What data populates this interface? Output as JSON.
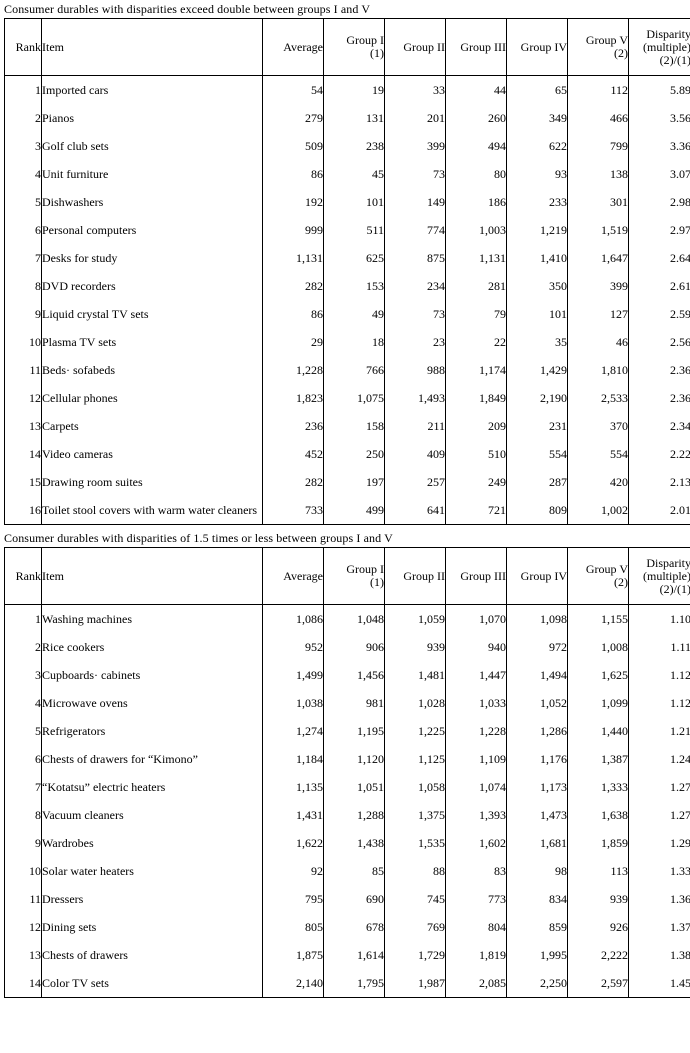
{
  "tables": [
    {
      "caption": "Consumer durables with disparities exceed double between groups I and V",
      "columns": {
        "rank": "Rank",
        "item": "Item",
        "average": "Average",
        "group1_l1": "Group I",
        "group1_l2": "(1)",
        "group2": "Group II",
        "group3": "Group III",
        "group4": "Group IV",
        "group5_l1": "Group V",
        "group5_l2": "(2)",
        "disparity_l1": "Disparity",
        "disparity_l2": "(multiple)",
        "disparity_l3": "(2)/(1)"
      },
      "rows": [
        {
          "rank": "1",
          "item": "Imported cars",
          "average": "54",
          "g1": "19",
          "g2": "33",
          "g3": "44",
          "g4": "65",
          "g5": "112",
          "disparity": "5.89"
        },
        {
          "rank": "2",
          "item": "Pianos",
          "average": "279",
          "g1": "131",
          "g2": "201",
          "g3": "260",
          "g4": "349",
          "g5": "466",
          "disparity": "3.56"
        },
        {
          "rank": "3",
          "item": "Golf club sets",
          "average": "509",
          "g1": "238",
          "g2": "399",
          "g3": "494",
          "g4": "622",
          "g5": "799",
          "disparity": "3.36"
        },
        {
          "rank": "4",
          "item": "Unit furniture",
          "average": "86",
          "g1": "45",
          "g2": "73",
          "g3": "80",
          "g4": "93",
          "g5": "138",
          "disparity": "3.07"
        },
        {
          "rank": "5",
          "item": "Dishwashers",
          "average": "192",
          "g1": "101",
          "g2": "149",
          "g3": "186",
          "g4": "233",
          "g5": "301",
          "disparity": "2.98"
        },
        {
          "rank": "6",
          "item": "Personal computers",
          "average": "999",
          "g1": "511",
          "g2": "774",
          "g3": "1,003",
          "g4": "1,219",
          "g5": "1,519",
          "disparity": "2.97"
        },
        {
          "rank": "7",
          "item": "Desks for study",
          "average": "1,131",
          "g1": "625",
          "g2": "875",
          "g3": "1,131",
          "g4": "1,410",
          "g5": "1,647",
          "disparity": "2.64"
        },
        {
          "rank": "8",
          "item": "DVD recorders",
          "average": "282",
          "g1": "153",
          "g2": "234",
          "g3": "281",
          "g4": "350",
          "g5": "399",
          "disparity": "2.61"
        },
        {
          "rank": "9",
          "item": "Liquid crystal TV sets",
          "average": "86",
          "g1": "49",
          "g2": "73",
          "g3": "79",
          "g4": "101",
          "g5": "127",
          "disparity": "2.59"
        },
        {
          "rank": "10",
          "item": "Plasma TV sets",
          "average": "29",
          "g1": "18",
          "g2": "23",
          "g3": "22",
          "g4": "35",
          "g5": "46",
          "disparity": "2.56"
        },
        {
          "rank": "11",
          "item": "Beds· sofabeds",
          "average": "1,228",
          "g1": "766",
          "g2": "988",
          "g3": "1,174",
          "g4": "1,429",
          "g5": "1,810",
          "disparity": "2.36"
        },
        {
          "rank": "12",
          "item": "Cellular phones",
          "average": "1,823",
          "g1": "1,075",
          "g2": "1,493",
          "g3": "1,849",
          "g4": "2,190",
          "g5": "2,533",
          "disparity": "2.36"
        },
        {
          "rank": "13",
          "item": "Carpets",
          "average": "236",
          "g1": "158",
          "g2": "211",
          "g3": "209",
          "g4": "231",
          "g5": "370",
          "disparity": "2.34"
        },
        {
          "rank": "14",
          "item": "Video cameras",
          "average": "452",
          "g1": "250",
          "g2": "409",
          "g3": "510",
          "g4": "554",
          "g5": "554",
          "disparity": "2.22"
        },
        {
          "rank": "15",
          "item": "Drawing room suites",
          "average": "282",
          "g1": "197",
          "g2": "257",
          "g3": "249",
          "g4": "287",
          "g5": "420",
          "disparity": "2.13"
        },
        {
          "rank": "16",
          "item": "Toilet stool covers with warm water cleaners",
          "average": "733",
          "g1": "499",
          "g2": "641",
          "g3": "721",
          "g4": "809",
          "g5": "1,002",
          "disparity": "2.01"
        }
      ]
    },
    {
      "caption": "Consumer durables with disparities of 1.5 times or less between groups I and V",
      "columns": {
        "rank": "Rank",
        "item": "Item",
        "average": "Average",
        "group1_l1": "Group I",
        "group1_l2": "(1)",
        "group2": "Group II",
        "group3": "Group III",
        "group4": "Group IV",
        "group5_l1": "Group V",
        "group5_l2": "(2)",
        "disparity_l1": "Disparity",
        "disparity_l2": "(multiple)",
        "disparity_l3": "(2)/(1)"
      },
      "rows": [
        {
          "rank": "1",
          "item": "Washing machines",
          "average": "1,086",
          "g1": "1,048",
          "g2": "1,059",
          "g3": "1,070",
          "g4": "1,098",
          "g5": "1,155",
          "disparity": "1.10"
        },
        {
          "rank": "2",
          "item": "Rice cookers",
          "average": "952",
          "g1": "906",
          "g2": "939",
          "g3": "940",
          "g4": "972",
          "g5": "1,008",
          "disparity": "1.11"
        },
        {
          "rank": "3",
          "item": "Cupboards· cabinets",
          "average": "1,499",
          "g1": "1,456",
          "g2": "1,481",
          "g3": "1,447",
          "g4": "1,494",
          "g5": "1,625",
          "disparity": "1.12"
        },
        {
          "rank": "4",
          "item": "Microwave ovens",
          "average": "1,038",
          "g1": "981",
          "g2": "1,028",
          "g3": "1,033",
          "g4": "1,052",
          "g5": "1,099",
          "disparity": "1.12"
        },
        {
          "rank": "5",
          "item": "Refrigerators",
          "average": "1,274",
          "g1": "1,195",
          "g2": "1,225",
          "g3": "1,228",
          "g4": "1,286",
          "g5": "1,440",
          "disparity": "1.21"
        },
        {
          "rank": "6",
          "item": "Chests of drawers for “Kimono”",
          "average": "1,184",
          "g1": "1,120",
          "g2": "1,125",
          "g3": "1,109",
          "g4": "1,176",
          "g5": "1,387",
          "disparity": "1.24"
        },
        {
          "rank": "7",
          "item": "“Kotatsu” electric heaters",
          "average": "1,135",
          "g1": "1,051",
          "g2": "1,058",
          "g3": "1,074",
          "g4": "1,173",
          "g5": "1,333",
          "disparity": "1.27"
        },
        {
          "rank": "8",
          "item": "Vacuum cleaners",
          "average": "1,431",
          "g1": "1,288",
          "g2": "1,375",
          "g3": "1,393",
          "g4": "1,473",
          "g5": "1,638",
          "disparity": "1.27"
        },
        {
          "rank": "9",
          "item": "Wardrobes",
          "average": "1,622",
          "g1": "1,438",
          "g2": "1,535",
          "g3": "1,602",
          "g4": "1,681",
          "g5": "1,859",
          "disparity": "1.29"
        },
        {
          "rank": "10",
          "item": "Solar water heaters",
          "average": "92",
          "g1": "85",
          "g2": "88",
          "g3": "83",
          "g4": "98",
          "g5": "113",
          "disparity": "1.33"
        },
        {
          "rank": "11",
          "item": "Dressers",
          "average": "795",
          "g1": "690",
          "g2": "745",
          "g3": "773",
          "g4": "834",
          "g5": "939",
          "disparity": "1.36"
        },
        {
          "rank": "12",
          "item": "Dining sets",
          "average": "805",
          "g1": "678",
          "g2": "769",
          "g3": "804",
          "g4": "859",
          "g5": "926",
          "disparity": "1.37"
        },
        {
          "rank": "13",
          "item": "Chests of drawers",
          "average": "1,875",
          "g1": "1,614",
          "g2": "1,729",
          "g3": "1,819",
          "g4": "1,995",
          "g5": "2,222",
          "disparity": "1.38"
        },
        {
          "rank": "14",
          "item": "Color TV sets",
          "average": "2,140",
          "g1": "1,795",
          "g2": "1,987",
          "g3": "2,085",
          "g4": "2,250",
          "g5": "2,597",
          "disparity": "1.45"
        }
      ]
    }
  ]
}
